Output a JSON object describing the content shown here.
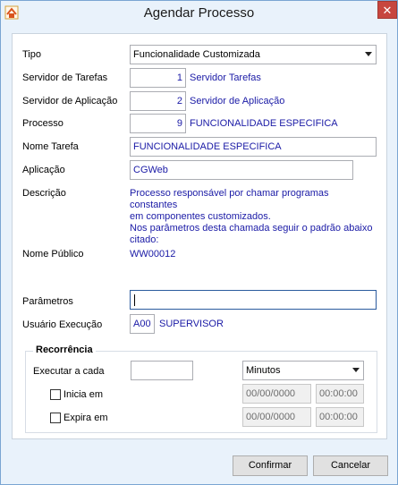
{
  "window": {
    "title": "Agendar Processo",
    "close_glyph": "✕"
  },
  "form": {
    "tipo": {
      "label": "Tipo",
      "value": "Funcionalidade Customizada"
    },
    "servidor_tarefas": {
      "label": "Servidor de Tarefas",
      "value": "1",
      "name": "Servidor Tarefas"
    },
    "servidor_aplicacao": {
      "label": "Servidor de Aplicação",
      "value": "2",
      "name": "Servidor de Aplicação"
    },
    "processo": {
      "label": "Processo",
      "value": "9",
      "name": "FUNCIONALIDADE ESPECIFICA"
    },
    "nome_tarefa": {
      "label": "Nome Tarefa",
      "value": "FUNCIONALIDADE ESPECIFICA"
    },
    "aplicacao": {
      "label": "Aplicação",
      "value": "CGWeb"
    },
    "descricao": {
      "label": "Descrição",
      "lines": [
        "Processo responsável por chamar programas constantes",
        "em componentes customizados.",
        "Nos parâmetros desta chamada seguir o padrão abaixo",
        "citado:"
      ]
    },
    "nome_publico": {
      "label": "Nome Público",
      "value": "WW00012"
    },
    "parametros": {
      "label": "Parâmetros",
      "value": ""
    },
    "usuario_execucao": {
      "label": "Usuário Execução",
      "code": "A00",
      "name": "SUPERVISOR"
    }
  },
  "recorrencia": {
    "title": "Recorrência",
    "executar_label": "Executar a cada",
    "executar_value": "",
    "unit": "Minutos",
    "inicia_label": "Inicia em",
    "inicia_date": "00/00/0000",
    "inicia_time": "00:00:00",
    "inicia_checked": false,
    "expira_label": "Expira em",
    "expira_date": "00/00/0000",
    "expira_time": "00:00:00",
    "expira_checked": false
  },
  "buttons": {
    "confirm": "Confirmar",
    "cancel": "Cancelar"
  }
}
